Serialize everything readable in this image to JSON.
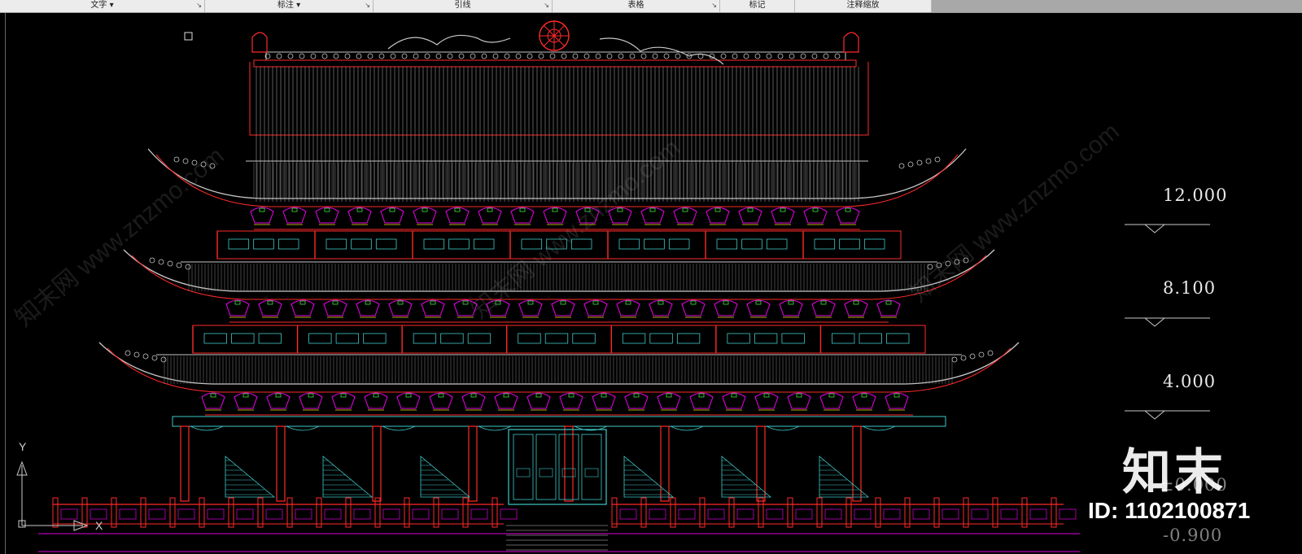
{
  "ribbon": {
    "panels": [
      {
        "label": "文字",
        "dropdown": true
      },
      {
        "label": "标注",
        "dropdown": true
      },
      {
        "label": "引线",
        "dropdown": false
      },
      {
        "label": "表格",
        "dropdown": false
      },
      {
        "label": "标记",
        "dropdown": false
      },
      {
        "label": "注释缩放",
        "dropdown": false
      }
    ],
    "dropdown_glyph": "▾",
    "launcher_glyph": "↘"
  },
  "drawing": {
    "elevations": [
      "12.000",
      "8.100",
      "4.000",
      "±0.000",
      "-0.900"
    ],
    "ucs": {
      "y_label": "Y",
      "x_label": "X"
    }
  },
  "watermark": {
    "brand": "知末",
    "id_text": "ID: 1102100871",
    "diagonal_text": "知末网 www.znzmo.com"
  },
  "colors": {
    "background": "#000000",
    "outline": "#c8c8c8",
    "red": "#ff2a2a",
    "magenta": "#e000e0",
    "cyan": "#40c8c8",
    "yellow": "#f0e000",
    "green": "#40e040"
  }
}
